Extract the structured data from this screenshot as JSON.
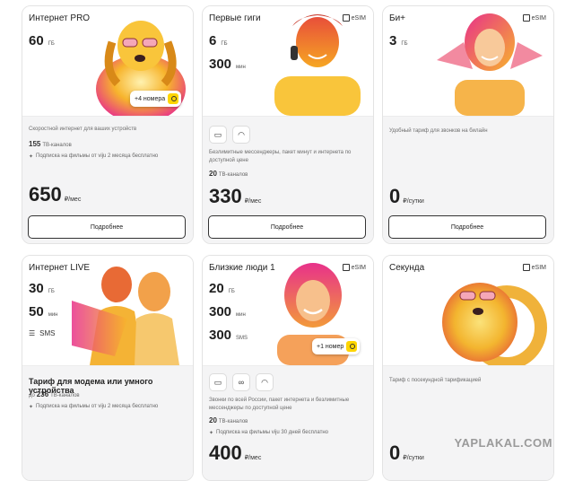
{
  "common": {
    "more_label": "Подробнее",
    "esim_label": "eSIM"
  },
  "cards": [
    {
      "name": "Интернет PRO",
      "gb": "60",
      "gb_unit": "ГБ",
      "badge": "+4 номера",
      "desc": "Скоростной интернет для ваших устройств",
      "tv_count": "155",
      "tv_label": "ТВ-каналов",
      "promo": "Подписка на фильмы от viju 2 месяца бесплатно",
      "price": "650",
      "price_unit": "₽/мес"
    },
    {
      "name": "Первые гиги",
      "esim": true,
      "gb": "6",
      "gb_unit": "ГБ",
      "min": "300",
      "min_unit": "мин",
      "desc": "Безлимитные мессенджеры, пакет минут и интернета по доступной цене",
      "tv_count": "20",
      "tv_label": "ТВ-каналов",
      "price": "330",
      "price_unit": "₽/мес"
    },
    {
      "name": "Би+",
      "esim": true,
      "gb": "3",
      "gb_unit": "ГБ",
      "desc": "Удобный тариф для звонков на билайн",
      "price": "0",
      "price_unit": "₽/сутки"
    },
    {
      "name": "Интернет LIVE",
      "gb": "30",
      "gb_unit": "ГБ",
      "min": "50",
      "min_unit": "мин",
      "sms_label": "SMS",
      "title": "Тариф для модема или умного устройства",
      "tv_prefix": "до",
      "tv_count": "236",
      "tv_label": "ТВ-каналов",
      "promo": "Подписка на фильмы от viju 2 месяца бесплатно"
    },
    {
      "name": "Близкие люди 1",
      "esim": true,
      "gb": "20",
      "gb_unit": "ГБ",
      "min": "300",
      "min_unit": "мин",
      "sms": "300",
      "sms_unit": "SMS",
      "badge": "+1 номер",
      "desc": "Звонки по всей России, пакет интернета и безлимитные мессенджеры по доступной цене",
      "tv_count": "20",
      "tv_label": "ТВ-каналов",
      "promo": "Подписка на фильмы viju 30 дней бесплатно",
      "price": "400",
      "price_unit": "₽/мес"
    },
    {
      "name": "Секунда",
      "esim": true,
      "desc": "Тариф с посекундной тарификацией",
      "price": "0",
      "price_unit": "₽/сутки"
    }
  ],
  "watermark": "YAPLAKAL.COM",
  "colors": {
    "accent": "#fed500",
    "photo_warm": "#f5a623",
    "photo_hot": "#e8318a"
  }
}
